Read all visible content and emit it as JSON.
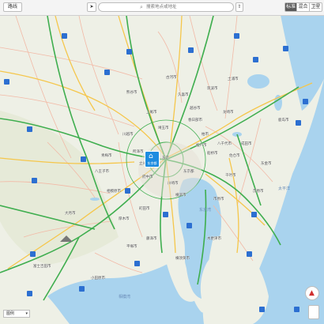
{
  "toolbar": {
    "directions_label": "路线",
    "location_icon": "location-arrow-icon",
    "search_placeholder": "搜索地点或地址",
    "share_icon": "share-icon",
    "view_modes": [
      "标准",
      "混合",
      "卫星"
    ],
    "active_view_mode": "标准"
  },
  "pin": {
    "label": "东京都",
    "side_label": "东京",
    "icon": "building-icon"
  },
  "scale": {
    "label": "图例"
  },
  "compass_icon": "compass-icon",
  "colors": {
    "land": "#eef0e6",
    "water": "#a9d3ee",
    "expressway": "#3fae4f",
    "highway": "#f5c64a",
    "road": "#f2b9a6",
    "shield": "#2c6fd1",
    "pin": "#1d8ce0"
  },
  "water_labels": [
    "东京湾",
    "太平洋",
    "相模湾"
  ],
  "places": [
    "东京都",
    "横滨市",
    "川崎市",
    "千叶市",
    "埼玉市",
    "川越市",
    "八王子市",
    "相模原市",
    "厚木市",
    "平塚市",
    "藤泽市",
    "横须贺市",
    "木更津市",
    "船桥市",
    "柏市",
    "松户市",
    "成田市",
    "佐仓市",
    "市原市",
    "茂原市",
    "东金市",
    "八千代市",
    "所泽市",
    "上尾市",
    "熊谷市",
    "小田原市",
    "富士吉田市",
    "大月市",
    "青梅市",
    "立川市",
    "府中市",
    "町田市",
    "春日部市",
    "越谷市",
    "久喜市",
    "古河市",
    "土浦市",
    "筑波市",
    "龙崎市",
    "鹿岛市"
  ]
}
